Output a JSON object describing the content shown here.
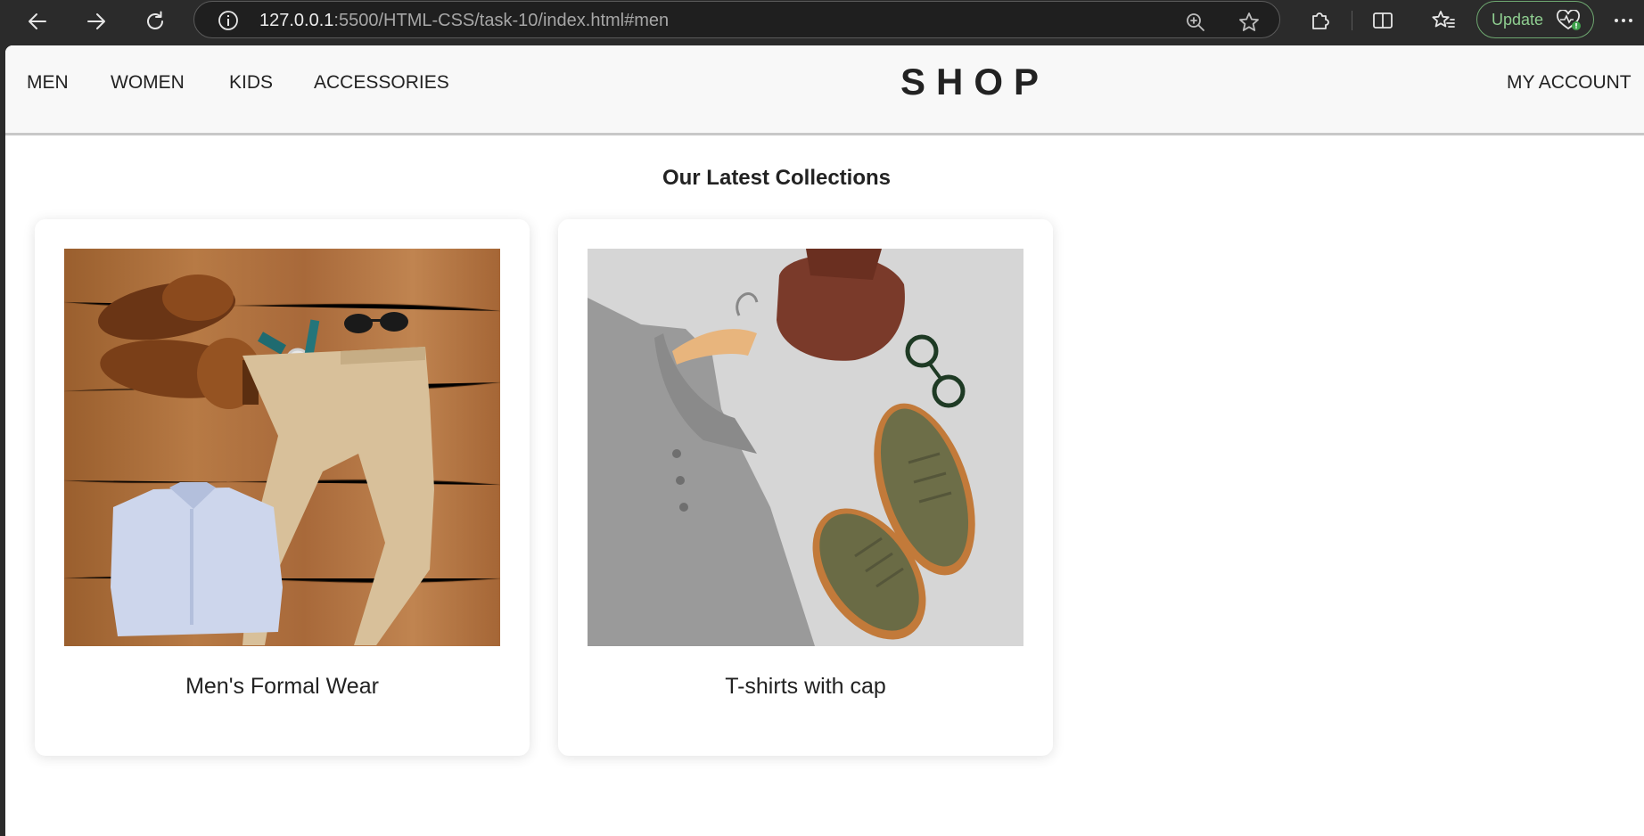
{
  "browser": {
    "url_host": "127.0.0.1",
    "url_rest": ":5500/HTML-CSS/task-10/index.html#men",
    "update_label": "Update"
  },
  "header": {
    "nav": [
      "MEN",
      "WOMEN",
      "KIDS",
      "ACCESSORIES"
    ],
    "logo": "SHOP",
    "account": "MY ACCOUNT"
  },
  "main": {
    "title": "Our Latest Collections",
    "cards": [
      {
        "caption": "Men's Formal Wear"
      },
      {
        "caption": "T-shirts with cap"
      }
    ]
  },
  "icons": {
    "back": "back-arrow-icon",
    "forward": "forward-arrow-icon",
    "reload": "reload-icon",
    "info": "info-icon",
    "zoom": "zoom-in-icon",
    "star": "star-icon",
    "extensions": "puzzle-icon",
    "split": "split-screen-icon",
    "favorites": "favorites-icon",
    "health": "heart-pulse-icon",
    "menu": "more-icon"
  },
  "colors": {
    "chrome_bg": "#2b2b2b",
    "header_bg": "#f8f8f8",
    "update_accent": "#8fce90",
    "text": "#222222"
  }
}
